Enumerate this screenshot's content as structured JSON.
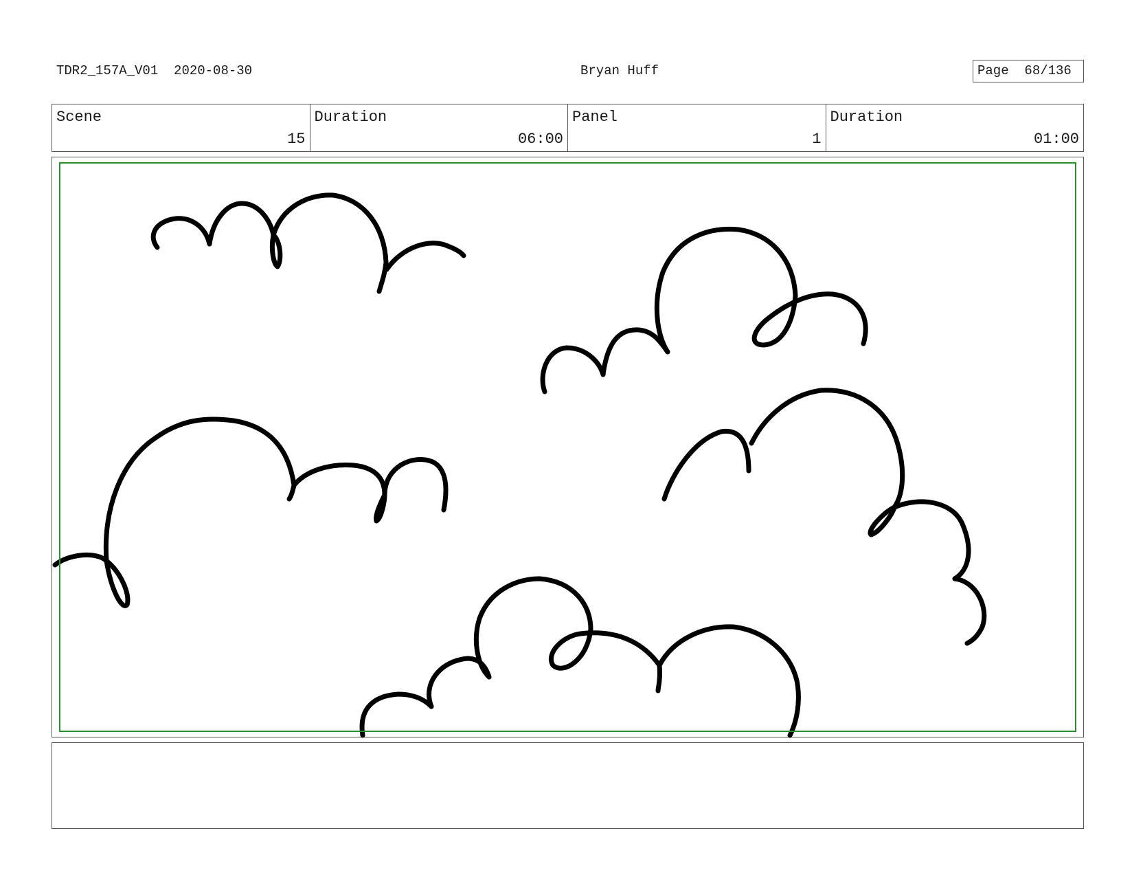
{
  "header": {
    "file_id": "TDR2_157A_V01",
    "date": "2020-08-30",
    "artist": "Bryan Huff",
    "page_label": "Page",
    "page_number": "68/136"
  },
  "info": {
    "scene_label": "Scene",
    "scene_value": "15",
    "scene_duration_label": "Duration",
    "scene_duration_value": "06:00",
    "panel_label": "Panel",
    "panel_value": "1",
    "panel_duration_label": "Duration",
    "panel_duration_value": "01:00"
  },
  "panel": {
    "frame_color": "#2e8b2e",
    "drawing": "clouds"
  },
  "notes": {
    "text": ""
  }
}
